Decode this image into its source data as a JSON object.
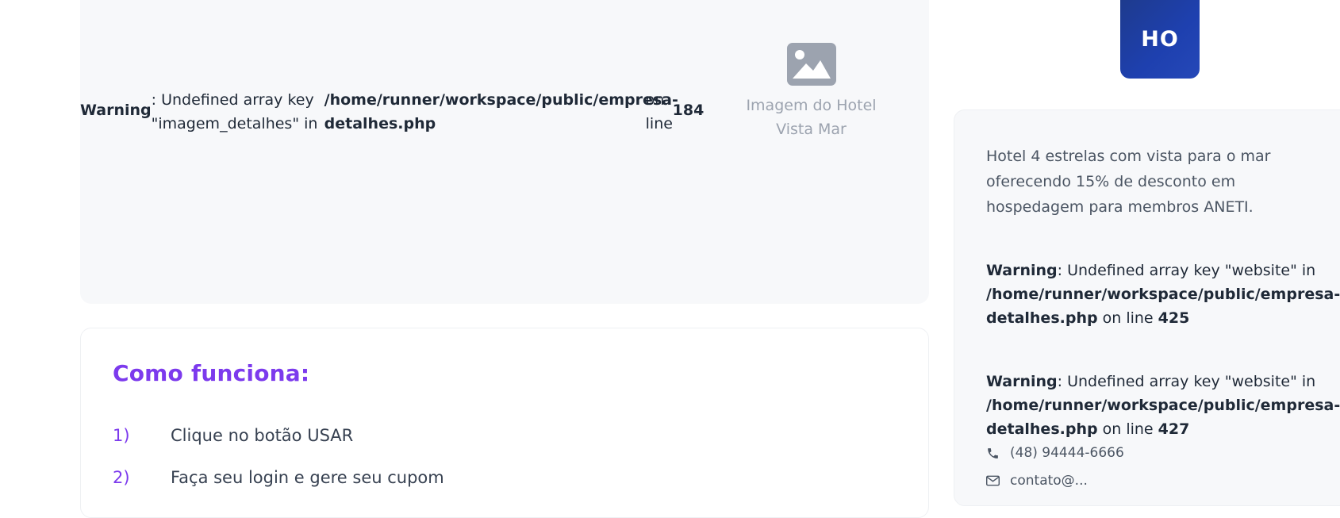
{
  "hero": {
    "warning_label": "Warning",
    "warning_message": ": Undefined array key \"imagem_detalhes\" in",
    "warning_path": "/home/runner/workspace/public/empresa-detalhes.php",
    "warning_on_line": "on line",
    "warning_line": "184",
    "image_icon": "image-icon",
    "image_alt": "Imagem do Hotel Vista Mar"
  },
  "how": {
    "title": "Como funciona:",
    "steps": [
      {
        "num": "1)",
        "text": "Clique no botão USAR"
      },
      {
        "num": "2)",
        "text": "Faça seu login e gere seu cupom"
      }
    ]
  },
  "sidebar": {
    "logo_text": "HO",
    "description": "Hotel 4 estrelas com vista para o mar oferecendo 15% de desconto em hospedagem para membros ANETI.",
    "warnings": [
      {
        "label": "Warning",
        "message": ": Undefined array key \"website\" in ",
        "path": "/home/runner/workspace/public/empresa-detalhes.php",
        "on_line": " on line ",
        "line": "425"
      },
      {
        "label": "Warning",
        "message": ": Undefined array key \"website\" in ",
        "path": "/home/runner/workspace/public/empresa-detalhes.php",
        "on_line": " on line ",
        "line": "427"
      }
    ],
    "phone_icon": "phone-icon",
    "phone": "(48) 94444-6666",
    "email_icon": "envelope-icon",
    "email": "contato@..."
  },
  "colors": {
    "accent": "#7c3aed",
    "logo_bg": "#1e40af",
    "panel_bg": "#f7f8fa"
  }
}
